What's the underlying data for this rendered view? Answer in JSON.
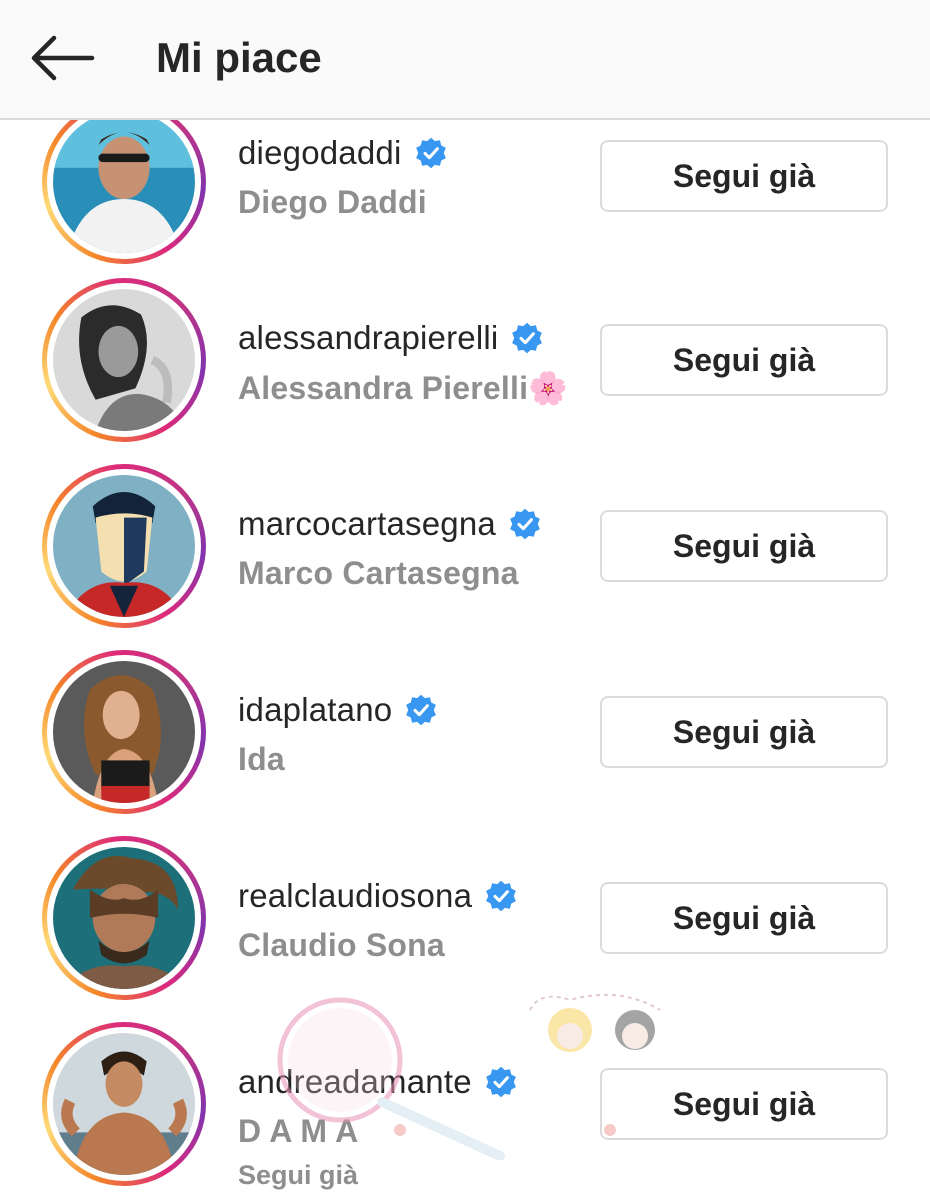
{
  "header": {
    "title": "Mi piace",
    "back_icon": "arrow-left-icon"
  },
  "colors": {
    "verified": "#3897f0",
    "muted_text": "#8e8e8e",
    "button_border": "#dbdbdb"
  },
  "users": [
    {
      "username": "diegodaddi",
      "full_name": "Diego Daddi",
      "button": "Segui già",
      "verified": true
    },
    {
      "username": "alessandrapierelli",
      "full_name": "Alessandra Pierelli🌸",
      "button": "Segui già",
      "verified": true
    },
    {
      "username": "marcocartasegna",
      "full_name": "Marco Cartasegna",
      "button": "Segui già",
      "verified": true
    },
    {
      "username": "idaplatano",
      "full_name": "Ida",
      "button": "Segui già",
      "verified": true
    },
    {
      "username": "realclaudiosona",
      "full_name": "Claudio Sona",
      "button": "Segui già",
      "verified": true
    },
    {
      "username": "andreadamante",
      "full_name": "D A M A",
      "subline": "Segui già",
      "button": "Segui già",
      "verified": true
    }
  ]
}
